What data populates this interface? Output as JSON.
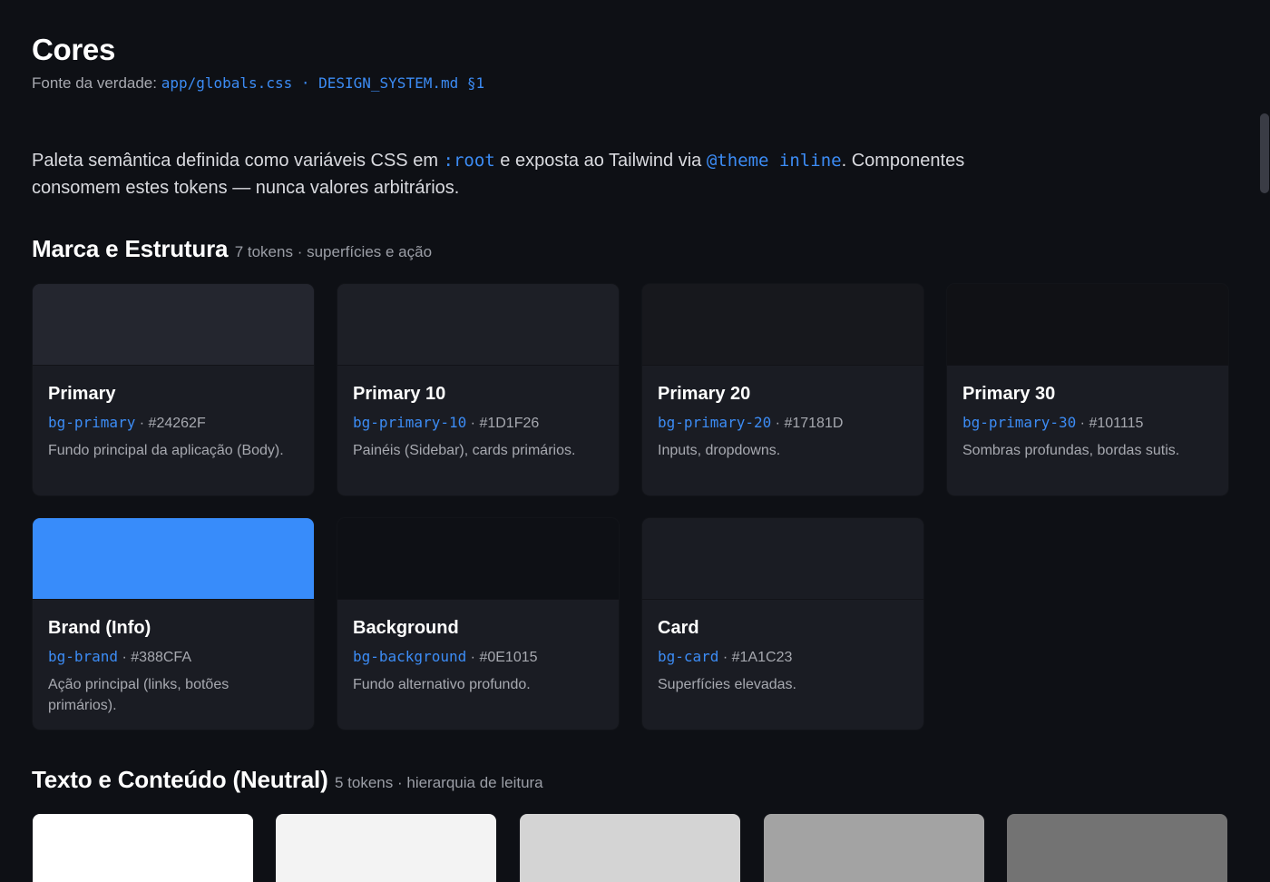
{
  "header": {
    "title": "Cores",
    "source_label": "Fonte da verdade:",
    "source_path": "app/globals.css · DESIGN_SYSTEM.md §1"
  },
  "intro": {
    "part1": "Paleta semântica definida como variáveis CSS em ",
    "code1": ":root",
    "part2": " e exposta ao Tailwind via ",
    "code2": "@theme inline",
    "part3": ". Componentes consomem estes tokens — nunca valores arbitrários."
  },
  "sections": [
    {
      "title": "Marca e Estrutura",
      "meta": "7 tokens · superfícies e ação",
      "swatches": [
        {
          "name": "Primary",
          "token": "bg-primary",
          "hex": "#24262F",
          "color": "#24262f",
          "desc": "Fundo principal da aplicação (Body)."
        },
        {
          "name": "Primary 10",
          "token": "bg-primary-10",
          "hex": "#1D1F26",
          "color": "#1d1f26",
          "desc": "Painéis (Sidebar), cards primários."
        },
        {
          "name": "Primary 20",
          "token": "bg-primary-20",
          "hex": "#17181D",
          "color": "#17181d",
          "desc": "Inputs, dropdowns."
        },
        {
          "name": "Primary 30",
          "token": "bg-primary-30",
          "hex": "#101115",
          "color": "#101115",
          "desc": "Sombras profundas, bordas sutis."
        },
        {
          "name": "Brand (Info)",
          "token": "bg-brand",
          "hex": "#388CFA",
          "color": "#388cfa",
          "desc": "Ação principal (links, botões primários)."
        },
        {
          "name": "Background",
          "token": "bg-background",
          "hex": "#0E1015",
          "color": "#0e1015",
          "desc": "Fundo alternativo profundo."
        },
        {
          "name": "Card",
          "token": "bg-card",
          "hex": "#1A1C23",
          "color": "#1a1c23",
          "desc": "Superfícies elevadas."
        }
      ]
    },
    {
      "title": "Texto e Conteúdo (Neutral)",
      "meta": "5 tokens · hierarquia de leitura",
      "swatches": [
        {
          "color": "#ffffff"
        },
        {
          "color": "#f3f3f3"
        },
        {
          "color": "#d4d4d4"
        },
        {
          "color": "#a3a3a3"
        },
        {
          "color": "#737373"
        }
      ]
    }
  ],
  "separator": " · ",
  "theme": {
    "page_background": "#0e1015",
    "card_background": "#1a1c23",
    "link": "#3c8cf5"
  }
}
